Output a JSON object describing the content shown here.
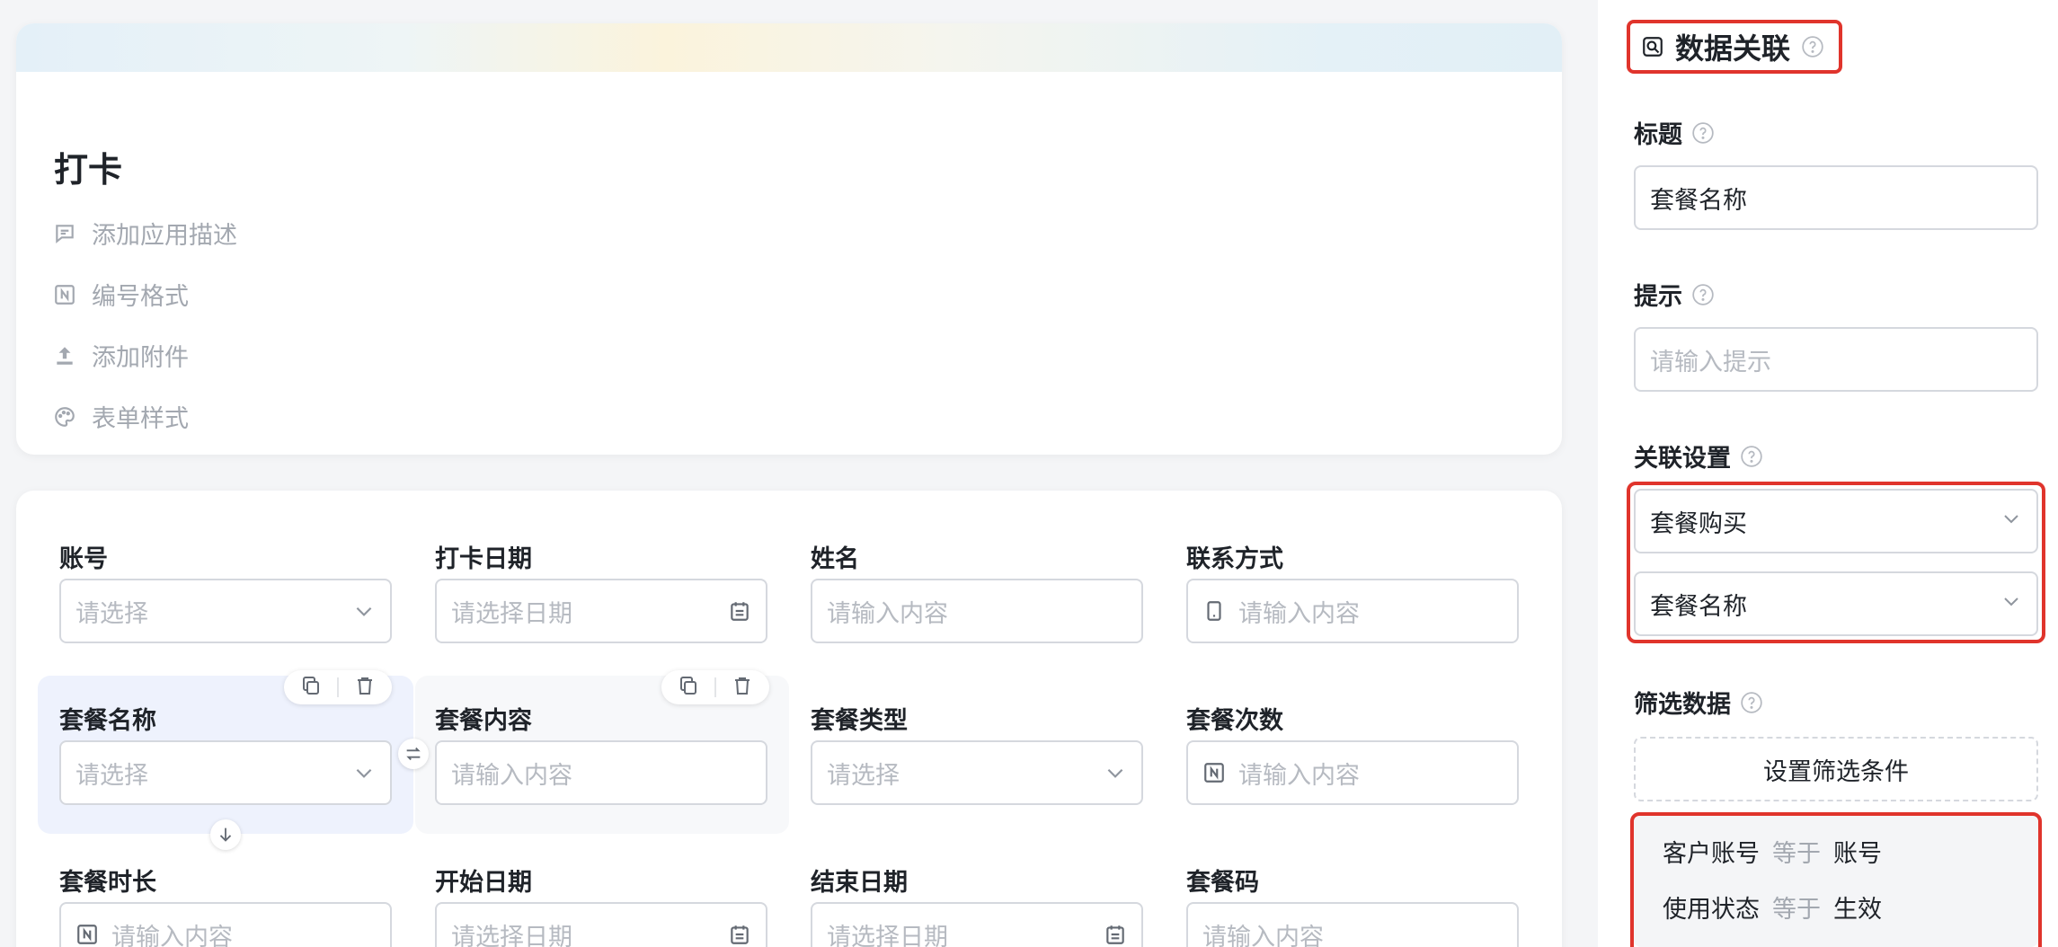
{
  "form": {
    "title": "打卡",
    "meta": [
      {
        "label": "添加应用描述",
        "icon": "comment-icon"
      },
      {
        "label": "编号格式",
        "icon": "number-format-icon"
      },
      {
        "label": "添加附件",
        "icon": "upload-icon"
      },
      {
        "label": "表单样式",
        "icon": "palette-icon"
      }
    ]
  },
  "fields": [
    {
      "label": "账号",
      "placeholder": "请选择",
      "kind": "select"
    },
    {
      "label": "打卡日期",
      "placeholder": "请选择日期",
      "kind": "date"
    },
    {
      "label": "姓名",
      "placeholder": "请输入内容",
      "kind": "text"
    },
    {
      "label": "联系方式",
      "placeholder": "请输入内容",
      "kind": "phone"
    },
    {
      "label": "套餐名称",
      "placeholder": "请选择",
      "kind": "select"
    },
    {
      "label": "套餐内容",
      "placeholder": "请输入内容",
      "kind": "text"
    },
    {
      "label": "套餐类型",
      "placeholder": "请选择",
      "kind": "select"
    },
    {
      "label": "套餐次数",
      "placeholder": "请输入内容",
      "kind": "number"
    },
    {
      "label": "套餐时长",
      "placeholder": "请输入内容",
      "kind": "number"
    },
    {
      "label": "开始日期",
      "placeholder": "请选择日期",
      "kind": "date"
    },
    {
      "label": "结束日期",
      "placeholder": "请选择日期",
      "kind": "date"
    },
    {
      "label": "套餐码",
      "placeholder": "请输入内容",
      "kind": "text"
    }
  ],
  "panel": {
    "title": "数据关联",
    "title_label": "标题",
    "title_value": "套餐名称",
    "hint_label": "提示",
    "hint_placeholder": "请输入提示",
    "link_label": "关联设置",
    "link_form": "套餐购买",
    "link_field": "套餐名称",
    "filter_label": "筛选数据",
    "filter_button": "设置筛选条件",
    "conditions": [
      {
        "field": "客户账号",
        "op": "等于",
        "value": "账号"
      },
      {
        "field": "使用状态",
        "op": "等于",
        "value": "生效"
      }
    ]
  },
  "colors": {
    "highlight_border": "#e0342c",
    "selected_field_bg": "#eef2fd"
  }
}
